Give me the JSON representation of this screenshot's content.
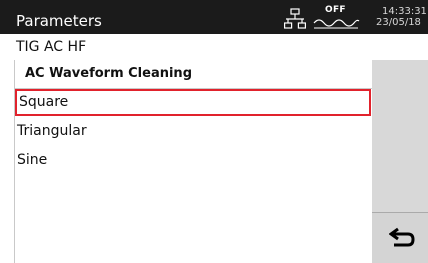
{
  "header": {
    "title": "Parameters",
    "network_icon": "network-topology-icon",
    "weld_status": {
      "label": "OFF",
      "icon": "weld-wave-icon"
    },
    "clock": {
      "time": "14:33:31",
      "date": "23/05/18"
    }
  },
  "breadcrumb": "TIG  AC  HF",
  "panel": {
    "title": "AC Waveform Cleaning",
    "options": [
      {
        "label": "Square",
        "selected": true
      },
      {
        "label": "Triangular",
        "selected": false
      },
      {
        "label": "Sine",
        "selected": false
      }
    ]
  },
  "side_panel": {
    "back_icon": "return-arrow-icon"
  },
  "colors": {
    "header_bg": "#1b1b1b",
    "selection_border": "#e1222c",
    "side_panel_bg": "#d8d8d8"
  }
}
